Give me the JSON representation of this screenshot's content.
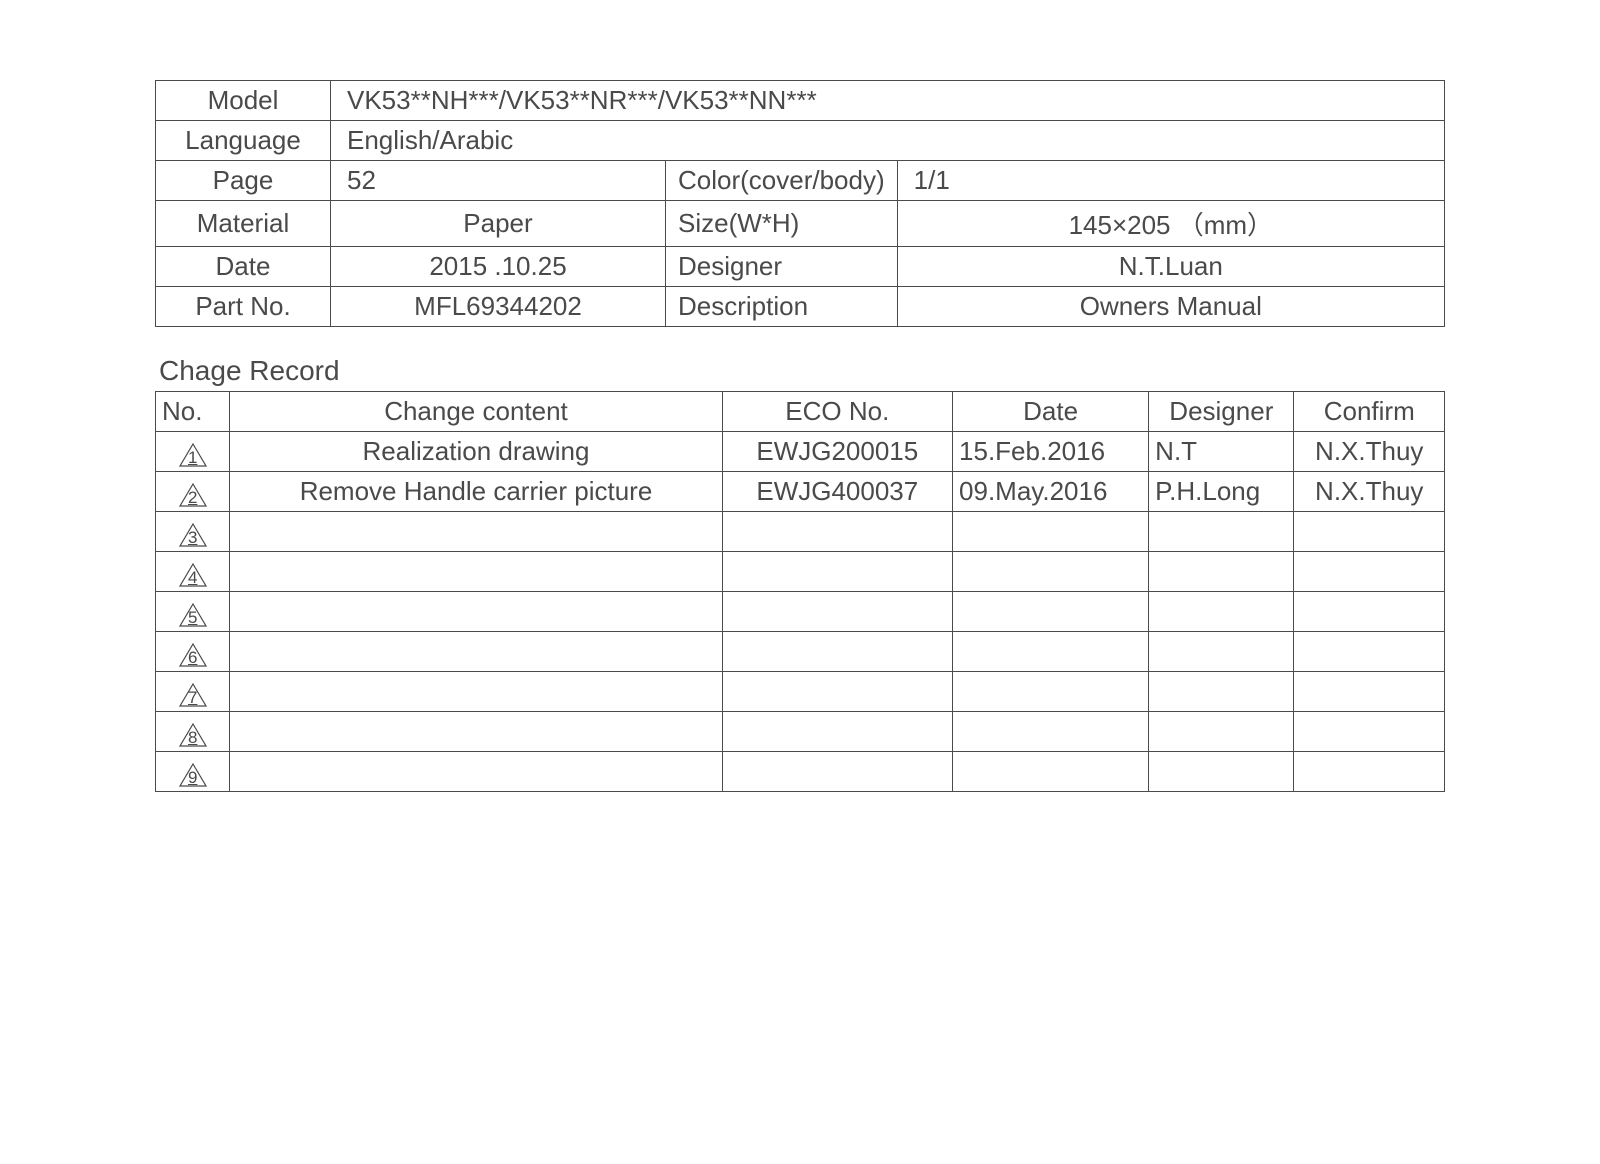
{
  "spec": {
    "model_label": "Model",
    "model_value": "VK53**NH***/VK53**NR***/VK53**NN***",
    "language_label": "Language",
    "language_value": "English/Arabic",
    "page_label": "Page",
    "page_value": "52",
    "color_label": "Color(cover/body)",
    "color_value": "1/1",
    "material_label": "Material",
    "material_value": "Paper",
    "size_label": "Size(W*H)",
    "size_value": "145×205 （mm）",
    "date_label": "Date",
    "date_value": "2015 .10.25",
    "designer_label": "Designer",
    "designer_value": "N.T.Luan",
    "partno_label": "Part No.",
    "partno_value": "MFL69344202",
    "description_label": "Description",
    "description_value": "Owners Manual"
  },
  "change_section_title": "Chage Record",
  "change_header": {
    "no": "No.",
    "content": "Change content",
    "eco": "ECO No.",
    "date": "Date",
    "designer": "Designer",
    "confirm": "Confirm"
  },
  "change_rows": [
    {
      "no": "1",
      "content": "Realization drawing",
      "eco": "EWJG200015",
      "date": "15.Feb.2016",
      "designer": "N.T",
      "confirm": "N.X.Thuy"
    },
    {
      "no": "2",
      "content": "Remove Handle carrier picture",
      "eco": "EWJG400037",
      "date": "09.May.2016",
      "designer": "P.H.Long",
      "confirm": "N.X.Thuy"
    },
    {
      "no": "3",
      "content": "",
      "eco": "",
      "date": "",
      "designer": "",
      "confirm": ""
    },
    {
      "no": "4",
      "content": "",
      "eco": "",
      "date": "",
      "designer": "",
      "confirm": ""
    },
    {
      "no": "5",
      "content": "",
      "eco": "",
      "date": "",
      "designer": "",
      "confirm": ""
    },
    {
      "no": "6",
      "content": "",
      "eco": "",
      "date": "",
      "designer": "",
      "confirm": ""
    },
    {
      "no": "7",
      "content": "",
      "eco": "",
      "date": "",
      "designer": "",
      "confirm": ""
    },
    {
      "no": "8",
      "content": "",
      "eco": "",
      "date": "",
      "designer": "",
      "confirm": ""
    },
    {
      "no": "9",
      "content": "",
      "eco": "",
      "date": "",
      "designer": "",
      "confirm": ""
    }
  ]
}
